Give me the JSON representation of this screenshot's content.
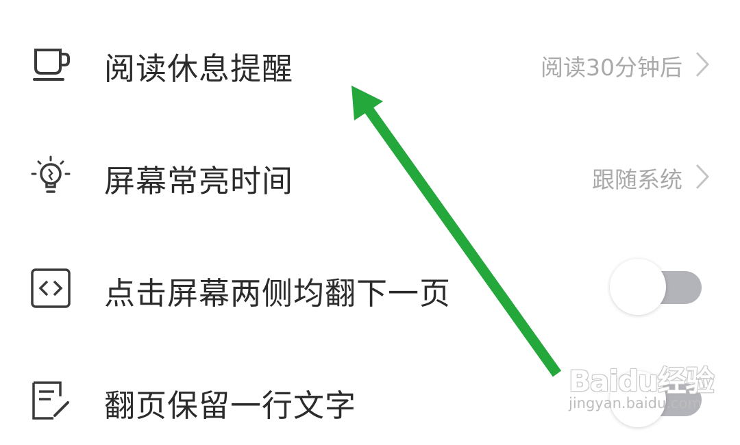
{
  "settings": {
    "rows": [
      {
        "label": "阅读休息提醒",
        "value": "阅读30分钟后",
        "icon": "cup-icon"
      },
      {
        "label": "屏幕常亮时间",
        "value": "跟随系统",
        "icon": "lightbulb-icon"
      },
      {
        "label": "点击屏幕两侧均翻下一页",
        "toggle": "off",
        "icon": "code-brackets-icon"
      },
      {
        "label": "翻页保留一行文字",
        "toggle": "off",
        "icon": "note-edit-icon"
      }
    ]
  },
  "overlay": {
    "arrow_color": "#24a83c"
  },
  "watermark": {
    "logo": "Baidu经验",
    "url": "jingyan.baidu.com"
  }
}
